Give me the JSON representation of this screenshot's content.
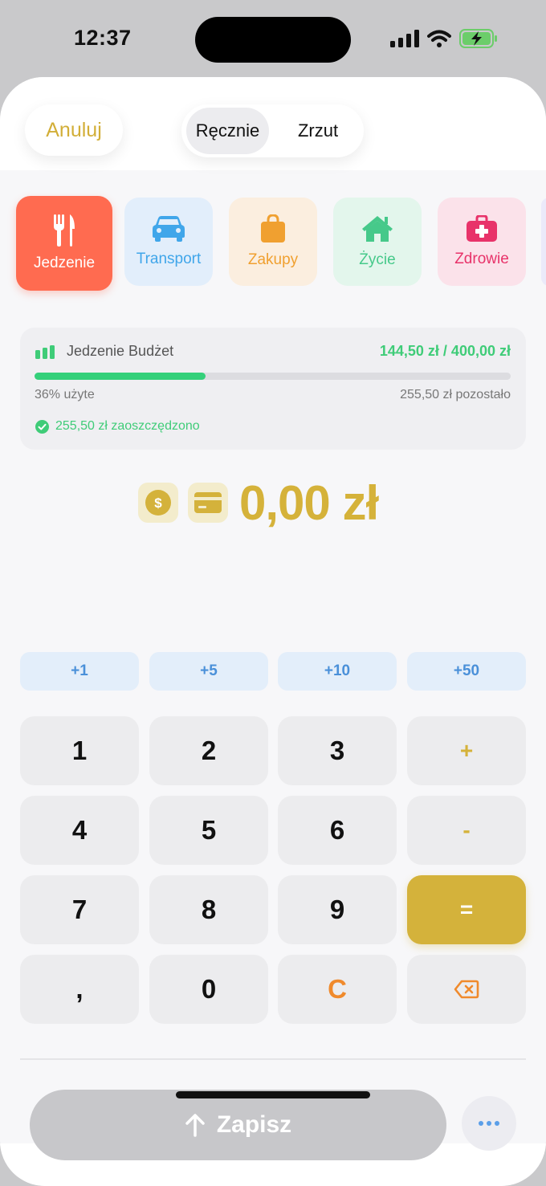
{
  "status_bar": {
    "time": "12:37"
  },
  "header": {
    "cancel_label": "Anuluj",
    "modes": [
      "Ręcznie",
      "Zrzut"
    ],
    "active_mode": "Ręcznie"
  },
  "categories": [
    {
      "label": "Jedzenie",
      "icon": "fork-knife-icon",
      "color": "#ff6b50",
      "selected": true
    },
    {
      "label": "Transport",
      "icon": "car-icon",
      "color": "#40a6ea",
      "selected": false
    },
    {
      "label": "Zakupy",
      "icon": "shopping-bag-icon",
      "color": "#f0a030",
      "selected": false
    },
    {
      "label": "Życie",
      "icon": "house-icon",
      "color": "#46c98a",
      "selected": false
    },
    {
      "label": "Zdrowie",
      "icon": "medical-kit-icon",
      "color": "#e8336a",
      "selected": false
    }
  ],
  "budget": {
    "title": "Jedzenie Budżet",
    "amount": "144,50 zł / 400,00 zł",
    "used_fraction": 0.36,
    "used_text": "36% użyte",
    "remaining_text": "255,50 zł pozostało",
    "saved_text": "255,50 zł zaoszczędzono"
  },
  "amount": {
    "value": "0,00 zł",
    "cash_icon": "dollar-coin-icon",
    "card_icon": "credit-card-icon"
  },
  "quick_add": [
    "+1",
    "+5",
    "+10",
    "+50"
  ],
  "keypad": {
    "keys": [
      "1",
      "2",
      "3",
      "+",
      "4",
      "5",
      "6",
      "-",
      "7",
      "8",
      "9",
      "=",
      ",",
      "0",
      "C",
      "backspace"
    ]
  },
  "footer": {
    "save_label": "Zapisz",
    "more_icon": "ellipsis-icon"
  },
  "colors": {
    "accent": "#d4b23b",
    "success": "#3fcc78",
    "quick": "#4a90d9",
    "clear": "#f08a2c"
  }
}
